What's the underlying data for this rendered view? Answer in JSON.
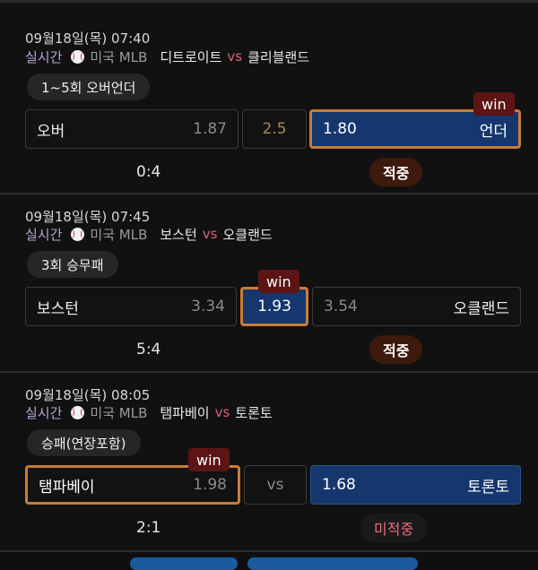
{
  "bets": [
    {
      "date": "09월18일(목) 07:40",
      "live": "실시간",
      "league": "미국 MLB",
      "home": "디트로이트",
      "vs": "vs",
      "away": "클리블랜드",
      "market": "1~5회 오버언더",
      "options": [
        {
          "label": "오버",
          "odd": "1.87"
        },
        {
          "label": "",
          "odd": "2.5"
        },
        {
          "label": "언더",
          "odd": "1.80"
        }
      ],
      "win_tag": "win",
      "score": "0:4",
      "result": "적중"
    },
    {
      "date": "09월18일(목) 07:45",
      "live": "실시간",
      "league": "미국 MLB",
      "home": "보스턴",
      "vs": "vs",
      "away": "오클랜드",
      "market": "3회 승무패",
      "options": [
        {
          "label": "보스턴",
          "odd": "3.34"
        },
        {
          "label": "",
          "odd": "1.93"
        },
        {
          "label": "오클랜드",
          "odd": "3.54"
        }
      ],
      "win_tag": "win",
      "score": "5:4",
      "result": "적중"
    },
    {
      "date": "09월18일(목) 08:05",
      "live": "실시간",
      "league": "미국 MLB",
      "home": "탬파베이",
      "vs": "vs",
      "away": "토론토",
      "market": "승패(연장포함)",
      "options": [
        {
          "label": "탬파베이",
          "odd": "1.98"
        },
        {
          "label": "",
          "odd": "vs"
        },
        {
          "label": "토론토",
          "odd": "1.68"
        }
      ],
      "win_tag": "win",
      "score": "2:1",
      "result": "미적중"
    }
  ],
  "colors": {
    "selected": "#16376e",
    "win_border": "#c97d34",
    "win_tag": "#5c1414",
    "live": "#b8a3d8",
    "vs": "#e0607a",
    "miss": "#f06a7a"
  }
}
